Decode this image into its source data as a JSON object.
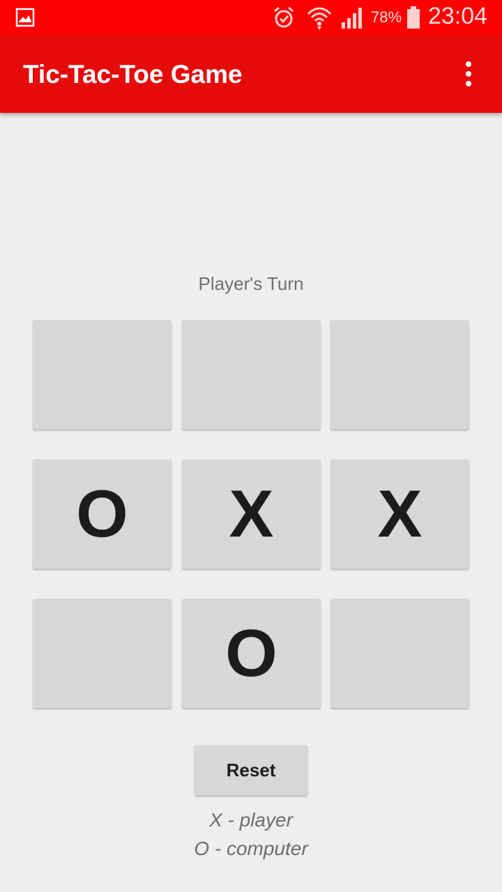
{
  "status_bar": {
    "battery_percent": "78%",
    "time": "23:04",
    "icons": [
      "gallery-icon",
      "alarm-icon",
      "wifi-icon",
      "signal-icon",
      "battery-icon"
    ],
    "background_color": "#ff0000"
  },
  "app_bar": {
    "title": "Tic-Tac-Toe Game",
    "background_color": "#e60b0b",
    "menu_icon": "overflow-menu-icon"
  },
  "game": {
    "turn_label": "Player's Turn",
    "board": [
      [
        "",
        "",
        ""
      ],
      [
        "O",
        "X",
        "X"
      ],
      [
        "",
        "O",
        ""
      ]
    ]
  },
  "reset_label": "Reset",
  "legend": {
    "player": "X - player",
    "computer": "O - computer"
  }
}
